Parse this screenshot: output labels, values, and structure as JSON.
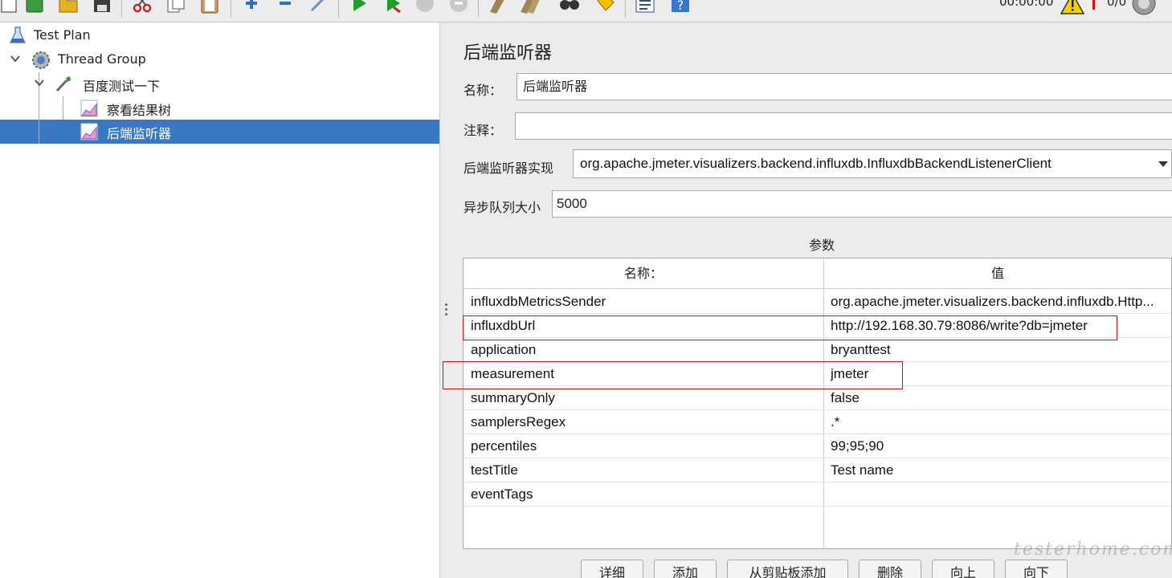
{
  "toolbar": {
    "timer": "00:00:00",
    "thread_count": "0/0",
    "icons": [
      "new-icon",
      "templates-icon",
      "open-icon",
      "save-icon",
      "cut-icon",
      "copy-icon",
      "paste-icon",
      "expand-icon",
      "collapse-icon",
      "toggle-icon",
      "start-icon",
      "start-no-pause-icon",
      "stop-icon",
      "shutdown-icon",
      "clear-icon",
      "clear-all-icon",
      "search-icon",
      "reset-search-icon",
      "function-helper-icon",
      "help-icon",
      "warning-icon",
      "remote-icon"
    ]
  },
  "tree": {
    "items": [
      {
        "label": "Test Plan",
        "icon": "flask-icon"
      },
      {
        "label": "Thread Group",
        "icon": "gear-icon"
      },
      {
        "label": "百度测试一下",
        "icon": "sampler-pipette-icon"
      },
      {
        "label": "察看结果树",
        "icon": "listener-graph-icon"
      },
      {
        "label": "后端监听器",
        "icon": "listener-graph-icon",
        "selected": true
      }
    ]
  },
  "panel": {
    "title": "后端监听器",
    "name_label": "名称：",
    "name_value": "后端监听器",
    "comment_label": "注释：",
    "comment_value": "",
    "impl_label": "后端监听器实现",
    "impl_value": "org.apache.jmeter.visualizers.backend.influxdb.InfluxdbBackendListenerClient",
    "queue_label": "异步队列大小",
    "queue_value": "5000",
    "params_title": "参数"
  },
  "table": {
    "headers": [
      "名称：",
      "值"
    ],
    "rows": [
      {
        "name": "influxdbMetricsSender",
        "value": "org.apache.jmeter.visualizers.backend.influxdb.Http..."
      },
      {
        "name": "influxdbUrl",
        "value": "http://192.168.30.79:8086/write?db=jmeter"
      },
      {
        "name": "application",
        "value": "bryanttest"
      },
      {
        "name": "measurement",
        "value": "jmeter"
      },
      {
        "name": "summaryOnly",
        "value": "false"
      },
      {
        "name": "samplersRegex",
        "value": ".*"
      },
      {
        "name": "percentiles",
        "value": "99;95;90"
      },
      {
        "name": "testTitle",
        "value": "Test name"
      },
      {
        "name": "eventTags",
        "value": ""
      }
    ]
  },
  "buttons": {
    "detail": "详细",
    "add": "添加",
    "add_from_clipboard": "从剪贴板添加",
    "delete": "删除",
    "up": "向上",
    "down": "向下"
  },
  "watermark": "testerhome.com",
  "colors": {
    "selection": "#3a79c1",
    "highlight_box": "#d01010"
  }
}
